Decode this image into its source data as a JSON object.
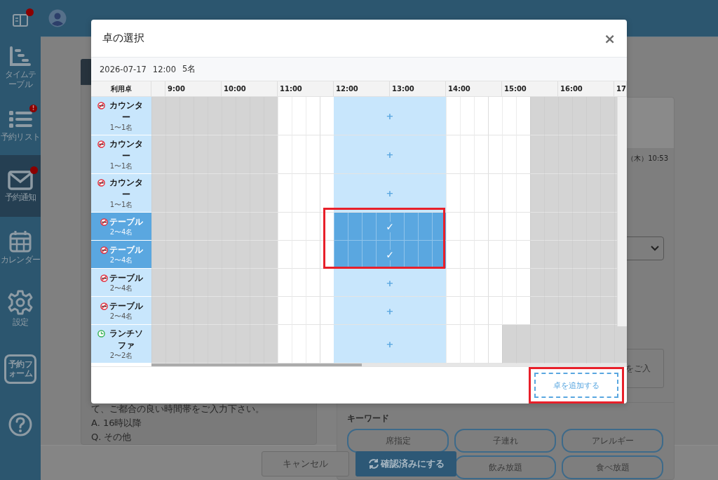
{
  "sidebar": {
    "items": [
      {
        "kind": "book",
        "dot": true,
        "selected": false
      },
      {
        "kind": "timetable",
        "label": "タイムテーブル",
        "dot": false,
        "selected": false
      },
      {
        "kind": "list",
        "label": "予約リスト",
        "dot": true,
        "badge_text": "!",
        "selected": false
      },
      {
        "kind": "mail",
        "label": "予約通知",
        "dot": true,
        "selected": true
      },
      {
        "kind": "calendar",
        "label": "カレンダー",
        "dot": false,
        "selected": false
      },
      {
        "kind": "settings",
        "label": "設定",
        "dot": false,
        "selected": false
      },
      {
        "kind": "form",
        "label": "予約フォーム",
        "dot": false,
        "selected": false
      },
      {
        "kind": "help",
        "dot": false,
        "selected": false
      }
    ]
  },
  "left_panel": {
    "lines": [
      "て、ご都合の良い時間帯をご入力下さい。",
      "A. 16時以降",
      "Q. その他"
    ]
  },
  "right_panel": {
    "datetime": "（木）10:53",
    "textarea_text": "をご入",
    "keyword_label": "キーワード",
    "keywords": [
      {
        "label": "席指定"
      },
      {
        "label": "子連れ"
      },
      {
        "label": "アレルギー"
      },
      {
        "label": "飲み放題"
      },
      {
        "label": "食べ放題"
      }
    ]
  },
  "footer": {
    "cancel": "キャンセル",
    "confirm": "確認済みにする"
  },
  "modal": {
    "title": "卓の選択",
    "close": "×",
    "date": "2026-07-17",
    "time": "12:00",
    "party": "5名",
    "timeline": {
      "name_header": "利用卓",
      "hours": [
        "9:00",
        "10:00",
        "11:00",
        "12:00",
        "13:00",
        "14:00",
        "15:00",
        "16:00",
        "17"
      ],
      "rows": [
        {
          "kind": "no_smoking",
          "name": "カウンター",
          "capacity": "1〜1名",
          "selected": false,
          "mark": "+",
          "slots": [
            {
              "kind": "closed"
            },
            {
              "kind": "closed"
            },
            {
              "kind": "closed"
            },
            {
              "kind": "closed"
            },
            {
              "kind": "closed"
            },
            {
              "kind": "closed"
            },
            {
              "kind": "closed"
            },
            {
              "kind": "closed"
            },
            {
              "kind": "closed"
            },
            {
              "kind": "open"
            },
            {
              "kind": "open"
            },
            {
              "kind": "open"
            },
            {
              "kind": "open"
            },
            {
              "kind": "request"
            },
            {
              "kind": "request"
            },
            {
              "kind": "request"
            },
            {
              "kind": "request"
            },
            {
              "kind": "request"
            },
            {
              "kind": "request"
            },
            {
              "kind": "request"
            },
            {
              "kind": "request"
            },
            {
              "kind": "open"
            },
            {
              "kind": "open"
            },
            {
              "kind": "open"
            },
            {
              "kind": "open"
            },
            {
              "kind": "open"
            },
            {
              "kind": "open"
            },
            {
              "kind": "closed"
            },
            {
              "kind": "closed"
            },
            {
              "kind": "closed"
            },
            {
              "kind": "closed"
            },
            {
              "kind": "closed"
            },
            {
              "kind": "closed"
            },
            {
              "kind": "closed"
            }
          ]
        },
        {
          "kind": "no_smoking",
          "name": "カウンター",
          "capacity": "1〜1名",
          "selected": false,
          "mark": "+",
          "slots": [
            {
              "kind": "closed"
            },
            {
              "kind": "closed"
            },
            {
              "kind": "closed"
            },
            {
              "kind": "closed"
            },
            {
              "kind": "closed"
            },
            {
              "kind": "closed"
            },
            {
              "kind": "closed"
            },
            {
              "kind": "closed"
            },
            {
              "kind": "closed"
            },
            {
              "kind": "open"
            },
            {
              "kind": "open"
            },
            {
              "kind": "open"
            },
            {
              "kind": "open"
            },
            {
              "kind": "request"
            },
            {
              "kind": "request"
            },
            {
              "kind": "request"
            },
            {
              "kind": "request"
            },
            {
              "kind": "request"
            },
            {
              "kind": "request"
            },
            {
              "kind": "request"
            },
            {
              "kind": "request"
            },
            {
              "kind": "open"
            },
            {
              "kind": "open"
            },
            {
              "kind": "open"
            },
            {
              "kind": "open"
            },
            {
              "kind": "open"
            },
            {
              "kind": "open"
            },
            {
              "kind": "closed"
            },
            {
              "kind": "closed"
            },
            {
              "kind": "closed"
            },
            {
              "kind": "closed"
            },
            {
              "kind": "closed"
            },
            {
              "kind": "closed"
            },
            {
              "kind": "closed"
            }
          ]
        },
        {
          "kind": "no_smoking",
          "name": "カウンター",
          "capacity": "1〜1名",
          "selected": false,
          "mark": "+",
          "slots": [
            {
              "kind": "closed"
            },
            {
              "kind": "closed"
            },
            {
              "kind": "closed"
            },
            {
              "kind": "closed"
            },
            {
              "kind": "closed"
            },
            {
              "kind": "closed"
            },
            {
              "kind": "closed"
            },
            {
              "kind": "closed"
            },
            {
              "kind": "closed"
            },
            {
              "kind": "open"
            },
            {
              "kind": "open"
            },
            {
              "kind": "open"
            },
            {
              "kind": "open"
            },
            {
              "kind": "request"
            },
            {
              "kind": "request"
            },
            {
              "kind": "request"
            },
            {
              "kind": "request"
            },
            {
              "kind": "request"
            },
            {
              "kind": "request"
            },
            {
              "kind": "request"
            },
            {
              "kind": "request"
            },
            {
              "kind": "open"
            },
            {
              "kind": "open"
            },
            {
              "kind": "open"
            },
            {
              "kind": "open"
            },
            {
              "kind": "open"
            },
            {
              "kind": "open"
            },
            {
              "kind": "closed"
            },
            {
              "kind": "closed"
            },
            {
              "kind": "closed"
            },
            {
              "kind": "closed"
            },
            {
              "kind": "closed"
            },
            {
              "kind": "closed"
            },
            {
              "kind": "closed"
            }
          ]
        },
        {
          "kind": "no_smoking",
          "name": "テーブル",
          "capacity": "2〜4名",
          "selected": true,
          "mark": "✓",
          "slots": [
            {
              "kind": "closed"
            },
            {
              "kind": "closed"
            },
            {
              "kind": "closed"
            },
            {
              "kind": "closed"
            },
            {
              "kind": "closed"
            },
            {
              "kind": "closed"
            },
            {
              "kind": "closed"
            },
            {
              "kind": "closed"
            },
            {
              "kind": "closed"
            },
            {
              "kind": "open"
            },
            {
              "kind": "open"
            },
            {
              "kind": "open"
            },
            {
              "kind": "open"
            },
            {
              "kind": "request"
            },
            {
              "kind": "request"
            },
            {
              "kind": "request"
            },
            {
              "kind": "request"
            },
            {
              "kind": "request"
            },
            {
              "kind": "request"
            },
            {
              "kind": "request"
            },
            {
              "kind": "request"
            },
            {
              "kind": "open"
            },
            {
              "kind": "open"
            },
            {
              "kind": "open"
            },
            {
              "kind": "open"
            },
            {
              "kind": "open"
            },
            {
              "kind": "open"
            },
            {
              "kind": "closed"
            },
            {
              "kind": "closed"
            },
            {
              "kind": "closed"
            },
            {
              "kind": "closed"
            },
            {
              "kind": "closed"
            },
            {
              "kind": "closed"
            },
            {
              "kind": "closed"
            }
          ]
        },
        {
          "kind": "no_smoking",
          "name": "テーブル",
          "capacity": "2〜4名",
          "selected": true,
          "mark": "✓",
          "slots": [
            {
              "kind": "closed"
            },
            {
              "kind": "closed"
            },
            {
              "kind": "closed"
            },
            {
              "kind": "closed"
            },
            {
              "kind": "closed"
            },
            {
              "kind": "closed"
            },
            {
              "kind": "closed"
            },
            {
              "kind": "closed"
            },
            {
              "kind": "closed"
            },
            {
              "kind": "open"
            },
            {
              "kind": "open"
            },
            {
              "kind": "open"
            },
            {
              "kind": "open"
            },
            {
              "kind": "request"
            },
            {
              "kind": "request"
            },
            {
              "kind": "request"
            },
            {
              "kind": "request"
            },
            {
              "kind": "request"
            },
            {
              "kind": "request"
            },
            {
              "kind": "request"
            },
            {
              "kind": "request"
            },
            {
              "kind": "open"
            },
            {
              "kind": "open"
            },
            {
              "kind": "open"
            },
            {
              "kind": "open"
            },
            {
              "kind": "open"
            },
            {
              "kind": "open"
            },
            {
              "kind": "closed"
            },
            {
              "kind": "closed"
            },
            {
              "kind": "closed"
            },
            {
              "kind": "closed"
            },
            {
              "kind": "closed"
            },
            {
              "kind": "closed"
            },
            {
              "kind": "closed"
            }
          ]
        },
        {
          "kind": "no_smoking",
          "name": "テーブル",
          "capacity": "2〜4名",
          "selected": false,
          "mark": "+",
          "slots": [
            {
              "kind": "closed"
            },
            {
              "kind": "closed"
            },
            {
              "kind": "closed"
            },
            {
              "kind": "closed"
            },
            {
              "kind": "closed"
            },
            {
              "kind": "closed"
            },
            {
              "kind": "closed"
            },
            {
              "kind": "closed"
            },
            {
              "kind": "closed"
            },
            {
              "kind": "open"
            },
            {
              "kind": "open"
            },
            {
              "kind": "open"
            },
            {
              "kind": "open"
            },
            {
              "kind": "request"
            },
            {
              "kind": "request"
            },
            {
              "kind": "request"
            },
            {
              "kind": "request"
            },
            {
              "kind": "request"
            },
            {
              "kind": "request"
            },
            {
              "kind": "request"
            },
            {
              "kind": "request"
            },
            {
              "kind": "open"
            },
            {
              "kind": "open"
            },
            {
              "kind": "open"
            },
            {
              "kind": "open"
            },
            {
              "kind": "open"
            },
            {
              "kind": "open"
            },
            {
              "kind": "closed"
            },
            {
              "kind": "closed"
            },
            {
              "kind": "closed"
            },
            {
              "kind": "closed"
            },
            {
              "kind": "closed"
            },
            {
              "kind": "closed"
            },
            {
              "kind": "closed"
            }
          ]
        },
        {
          "kind": "no_smoking",
          "name": "テーブル",
          "capacity": "2〜4名",
          "selected": false,
          "mark": "+",
          "slots": [
            {
              "kind": "closed"
            },
            {
              "kind": "closed"
            },
            {
              "kind": "closed"
            },
            {
              "kind": "closed"
            },
            {
              "kind": "closed"
            },
            {
              "kind": "closed"
            },
            {
              "kind": "closed"
            },
            {
              "kind": "closed"
            },
            {
              "kind": "closed"
            },
            {
              "kind": "open"
            },
            {
              "kind": "open"
            },
            {
              "kind": "open"
            },
            {
              "kind": "open"
            },
            {
              "kind": "request"
            },
            {
              "kind": "request"
            },
            {
              "kind": "request"
            },
            {
              "kind": "request"
            },
            {
              "kind": "request"
            },
            {
              "kind": "request"
            },
            {
              "kind": "request"
            },
            {
              "kind": "request"
            },
            {
              "kind": "open"
            },
            {
              "kind": "open"
            },
            {
              "kind": "open"
            },
            {
              "kind": "open"
            },
            {
              "kind": "open"
            },
            {
              "kind": "open"
            },
            {
              "kind": "closed"
            },
            {
              "kind": "closed"
            },
            {
              "kind": "closed"
            },
            {
              "kind": "closed"
            },
            {
              "kind": "closed"
            },
            {
              "kind": "closed"
            },
            {
              "kind": "closed"
            }
          ]
        },
        {
          "kind": "lunch",
          "name": "ランチソファ",
          "capacity": "2〜2名",
          "selected": false,
          "mark": "+",
          "slots": [
            {
              "kind": "closed"
            },
            {
              "kind": "closed"
            },
            {
              "kind": "closed"
            },
            {
              "kind": "closed"
            },
            {
              "kind": "closed"
            },
            {
              "kind": "closed"
            },
            {
              "kind": "closed"
            },
            {
              "kind": "closed"
            },
            {
              "kind": "closed"
            },
            {
              "kind": "open"
            },
            {
              "kind": "open"
            },
            {
              "kind": "open"
            },
            {
              "kind": "open"
            },
            {
              "kind": "request"
            },
            {
              "kind": "request"
            },
            {
              "kind": "request"
            },
            {
              "kind": "request"
            },
            {
              "kind": "request"
            },
            {
              "kind": "request"
            },
            {
              "kind": "request"
            },
            {
              "kind": "request"
            },
            {
              "kind": "open"
            },
            {
              "kind": "open"
            },
            {
              "kind": "open"
            },
            {
              "kind": "open"
            },
            {
              "kind": "closed"
            },
            {
              "kind": "closed"
            },
            {
              "kind": "closed"
            },
            {
              "kind": "closed"
            },
            {
              "kind": "closed"
            },
            {
              "kind": "closed"
            },
            {
              "kind": "closed"
            },
            {
              "kind": "closed"
            },
            {
              "kind": "closed"
            }
          ]
        }
      ]
    },
    "add_button": "卓を追加する"
  }
}
